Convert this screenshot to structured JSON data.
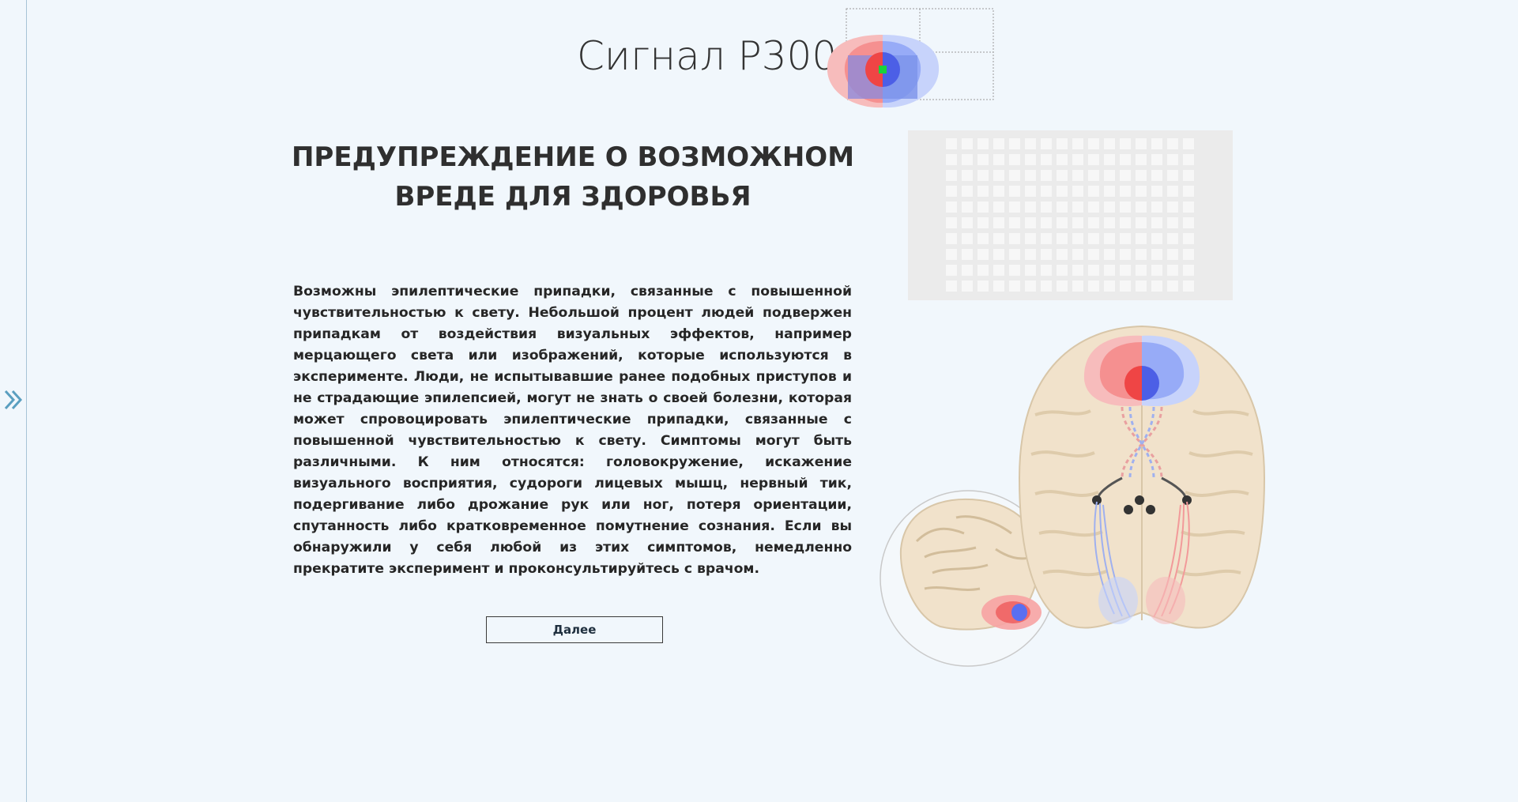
{
  "app": {
    "title": "Сигнал P300"
  },
  "sidebar": {
    "toggle_icon": "double-chevron-right-icon",
    "accent_color": "#5a9fc0"
  },
  "warning": {
    "heading": "ПРЕДУПРЕЖДЕНИЕ О ВОЗМОЖНОМ ВРЕДЕ ДЛЯ ЗДОРОВЬЯ",
    "body": "Возможны эпилептические припадки, связанные с повышенной чувствительностью к свету. Небольшой процент людей подвержен припадкам от воздействия визуальных эффектов, например мерцающего света или изображений, которые используются в эксперименте. Люди, не испытывавшие ранее подобных приступов и не страдающие эпилепсией, могут не знать о своей болезни, которая может спровоцировать эпилептические припадки, связанные с повышенной чувствительностью к свету. Симптомы могут быть различными. К ним относятся: головокружение, искажение визуального восприятия, судороги лицевых мышц, нервный тик, подергивание либо дрожание рук или ног, потеря ориентации, спутанность либо кратковременное помутнение сознания. Если вы обнаружили у себя любой из этих симптомов, немедленно прекратите эксперимент и проконсультируйтесь с врачом."
  },
  "actions": {
    "next_label": "Далее"
  },
  "illustrations": {
    "logo_icon": "visual-field-logo-icon",
    "stimulus_grid_icon": "p300-stimulus-matrix-icon",
    "brain_icon": "brain-visual-pathway-illustration-icon",
    "colors": {
      "left_field": "#f25b5b",
      "right_field": "#5a6ff0",
      "fixation": "#19d23c",
      "brain_tissue": "#f1e2cb"
    }
  }
}
